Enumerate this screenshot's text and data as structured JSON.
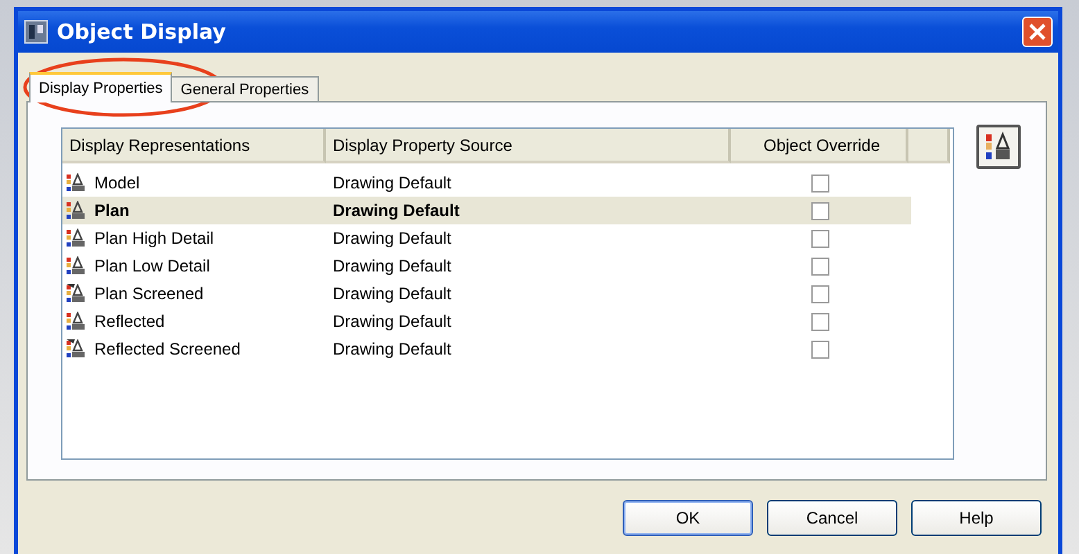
{
  "window": {
    "title": "Object Display"
  },
  "tabs": [
    {
      "label": "Display Properties",
      "selected": true,
      "circled": true
    },
    {
      "label": "General Properties",
      "selected": false,
      "circled": false
    }
  ],
  "table": {
    "columns": [
      "Display Representations",
      "Display Property Source",
      "Object Override"
    ],
    "rows": [
      {
        "name": "Model",
        "source": "Drawing Default",
        "override": false,
        "selected": false,
        "screened": false
      },
      {
        "name": "Plan",
        "source": "Drawing Default",
        "override": false,
        "selected": true,
        "screened": false
      },
      {
        "name": "Plan High Detail",
        "source": "Drawing Default",
        "override": false,
        "selected": false,
        "screened": false
      },
      {
        "name": "Plan Low Detail",
        "source": "Drawing Default",
        "override": false,
        "selected": false,
        "screened": false
      },
      {
        "name": "Plan Screened",
        "source": "Drawing Default",
        "override": false,
        "selected": false,
        "screened": true
      },
      {
        "name": "Reflected",
        "source": "Drawing Default",
        "override": false,
        "selected": false,
        "screened": false
      },
      {
        "name": "Reflected Screened",
        "source": "Drawing Default",
        "override": false,
        "selected": false,
        "screened": true
      }
    ]
  },
  "buttons": [
    {
      "label": "OK",
      "default": true
    },
    {
      "label": "Cancel",
      "default": false
    },
    {
      "label": "Help",
      "default": false
    }
  ]
}
